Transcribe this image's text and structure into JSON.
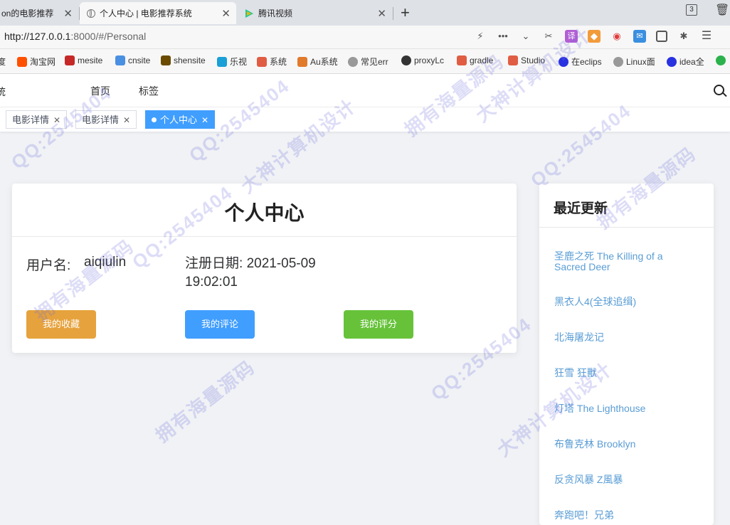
{
  "browser": {
    "tabs": [
      {
        "title": "on的电影推荐",
        "active": false
      },
      {
        "title": "个人中心 | 电影推荐系统",
        "active": true
      },
      {
        "title": "腾讯视频",
        "active": false
      }
    ],
    "tab_count": "3",
    "url_host": "http://127.0.0.1",
    "url_rest": ":8000/#/Personal",
    "bookmarks": [
      {
        "label": "度",
        "color": "#2932e1"
      },
      {
        "label": "淘宝网",
        "color": "#ff5000"
      },
      {
        "label": "mesite",
        "color": "#c62828"
      },
      {
        "label": "cnsite",
        "color": "#4a90e2"
      },
      {
        "label": "shensite",
        "color": "#6a4b00"
      },
      {
        "label": "乐视",
        "color": "#1a9fd6"
      },
      {
        "label": "系统",
        "color": "#e05d44"
      },
      {
        "label": "Au系统",
        "color": "#e07a2c"
      },
      {
        "label": "常见err",
        "color": "#888888"
      },
      {
        "label": "proxyLc",
        "color": "#333333"
      },
      {
        "label": "gradle",
        "color": "#e05d44"
      },
      {
        "label": "Studio",
        "color": "#e05d44"
      },
      {
        "label": "在eclips",
        "color": "#2932e1"
      },
      {
        "label": "Linux面",
        "color": "#888888"
      },
      {
        "label": "idea全",
        "color": "#2932e1"
      }
    ]
  },
  "nav": {
    "logo": "统",
    "links": [
      "首页",
      "标签"
    ]
  },
  "tags": [
    {
      "label": "电影详情",
      "active": false
    },
    {
      "label": "电影详情",
      "active": false
    },
    {
      "label": "个人中心",
      "active": true
    }
  ],
  "personal": {
    "title": "个人中心",
    "username_label": "用户名:",
    "username": "aiqiulin",
    "reg_label": "注册日期:",
    "reg_date": "2021-05-09 19:02:01",
    "buttons": {
      "favorites": "我的收藏",
      "comments": "我的评论",
      "ratings": "我的评分"
    }
  },
  "recent": {
    "title": "最近更新",
    "items": [
      "圣鹿之死 The Killing of a Sacred Deer",
      "黑衣人4(全球追缉)",
      "北海屠龙记",
      "狂雪 狂獸",
      "灯塔 The Lighthouse",
      "布鲁克林 Brooklyn",
      "反贪风暴 Z風暴",
      "奔跑吧！兄弟"
    ]
  },
  "watermark": [
    "拥有海量源码",
    "QQ:2545404",
    "大神计算机设计"
  ],
  "colors": {
    "primary": "#409eff",
    "warning": "#e6a23c",
    "success": "#67c23a",
    "link": "#5a9dd5"
  }
}
